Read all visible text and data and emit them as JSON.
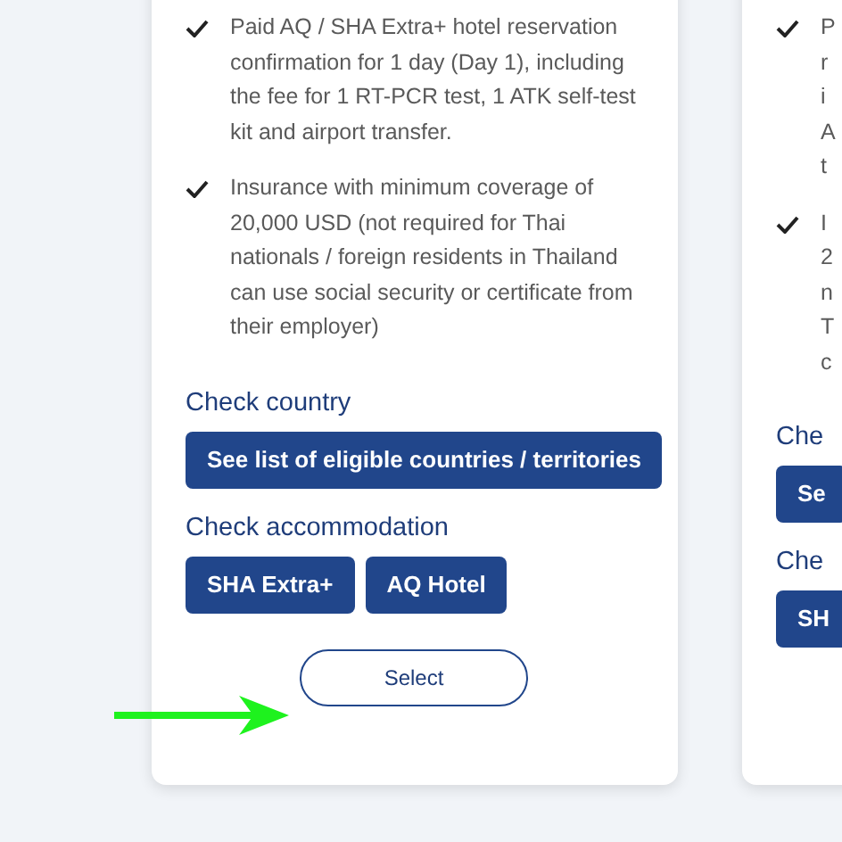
{
  "cards": [
    {
      "bullets": [
        {
          "text": "Paid AQ / SHA Extra+ hotel reservation confirmation for 1 day (Day 1), including the fee for 1 RT-PCR test, 1 ATK self-test kit and airport transfer."
        },
        {
          "text": "Insurance with minimum coverage of 20,000 USD (not required for Thai nationals / foreign residents in Thailand can use social security or certificate from their employer)"
        }
      ],
      "sections": [
        {
          "heading": "Check country",
          "buttons": [
            "See list of eligible countries / territories"
          ]
        },
        {
          "heading": "Check accommodation",
          "buttons": [
            "SHA Extra+",
            "AQ Hotel"
          ]
        }
      ],
      "select": "Select"
    },
    {
      "bullets": [
        {
          "lines": [
            "P",
            "r",
            "i",
            "A",
            "t"
          ]
        },
        {
          "lines": [
            "I",
            "2",
            "n",
            "T",
            "c"
          ]
        }
      ],
      "sections": [
        {
          "heading": "Che",
          "buttons": [
            "Se"
          ]
        },
        {
          "heading": "Che",
          "buttons": [
            "SH"
          ]
        }
      ]
    }
  ]
}
